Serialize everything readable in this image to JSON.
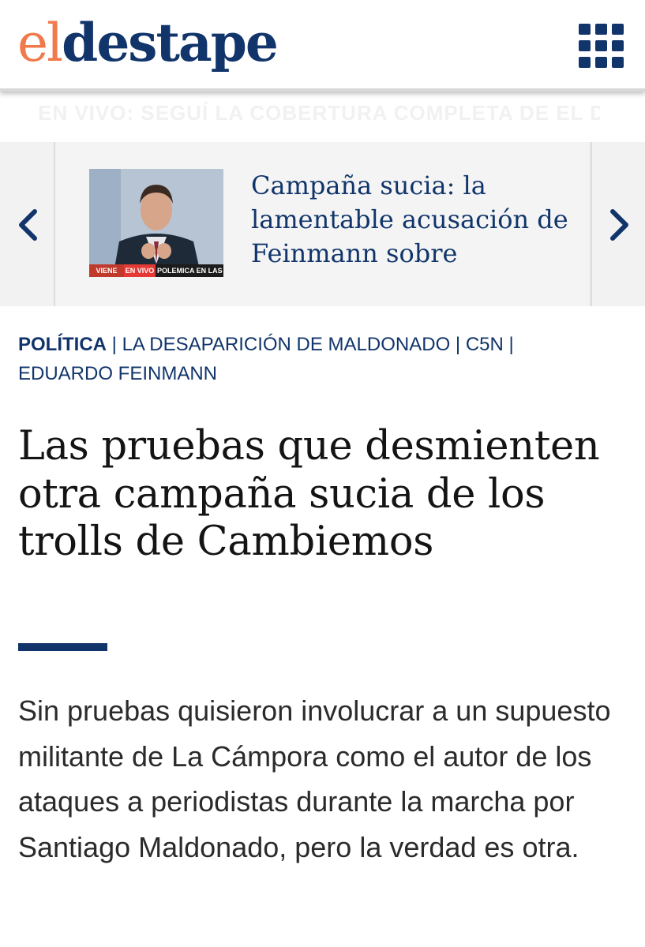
{
  "header": {
    "logo_el": "el",
    "logo_destape": "destape",
    "menu_icon": "grid-menu-icon"
  },
  "ticker": {
    "text": "EN VIVO: SEGUÍ LA COBERTURA COMPLETA DE EL DESTAPE SOBRE LA ACTUALIDAD"
  },
  "carousel": {
    "prev_icon": "chevron-left-icon",
    "next_icon": "chevron-right-icon",
    "thumbnail": {
      "badge_viene": "VIENE",
      "badge_live": "EN VIVO",
      "caption": "POLEMICA EN LAS E"
    },
    "title": "Campaña sucia: la lamentable acusación de Feinmann sobre"
  },
  "tags": {
    "section": "POLÍTICA",
    "items": [
      "LA DESAPARICIÓN DE MALDONADO",
      "C5N",
      "EDUARDO FEINMANN"
    ],
    "separator": "|"
  },
  "article": {
    "headline": "Las pruebas que desmienten otra campaña sucia de los trolls de Cambiemos",
    "lead": "Sin pruebas quisieron involucrar a un supuesto militante de La Cámpora como el autor de los ataques a periodistas durante la marcha por Santiago Maldonado, pero la verdad es otra."
  },
  "colors": {
    "brand_navy": "#11356b",
    "brand_orange": "#f07a4b",
    "text_dark": "#141414",
    "carousel_bg": "#efefef"
  }
}
